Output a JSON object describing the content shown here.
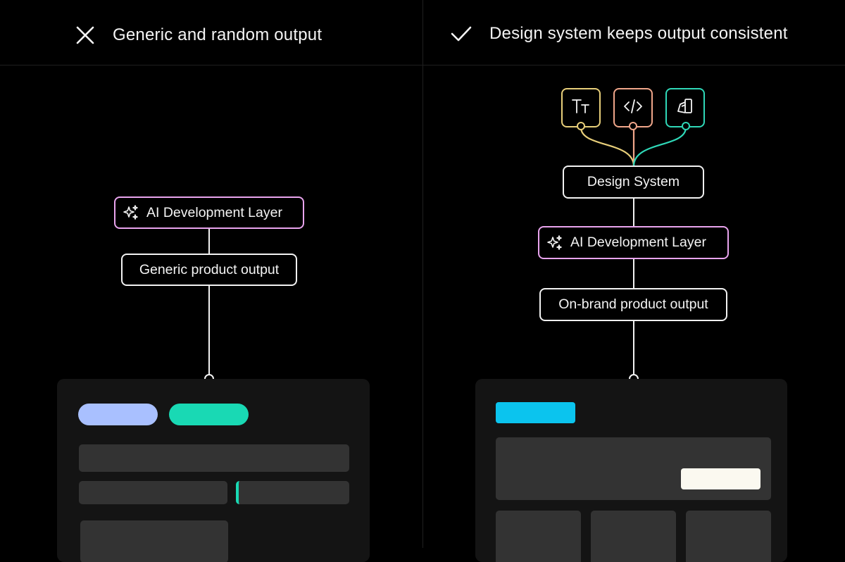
{
  "left_panel": {
    "heading": "Generic and random output",
    "heading_icon": "close-icon",
    "ai_layer_label": "AI Development Layer",
    "output_label": "Generic product output"
  },
  "right_panel": {
    "heading": "Design system keeps output consistent",
    "heading_icon": "check-icon",
    "tokens": [
      {
        "icon": "typography-icon",
        "color": "#e8cf7a"
      },
      {
        "icon": "code-icon",
        "color": "#f0a68a"
      },
      {
        "icon": "components-icon",
        "color": "#2fd8b8"
      }
    ],
    "design_system_label": "Design System",
    "ai_layer_label": "AI Development Layer",
    "output_label": "On-brand product output"
  },
  "colors": {
    "ai_border": "#e9a4ee",
    "pill_lavender": "#a9c0ff",
    "pill_teal": "#19d9b4",
    "accent_cyan": "#0bc4ee",
    "accent_cream": "#fbf9f0"
  }
}
